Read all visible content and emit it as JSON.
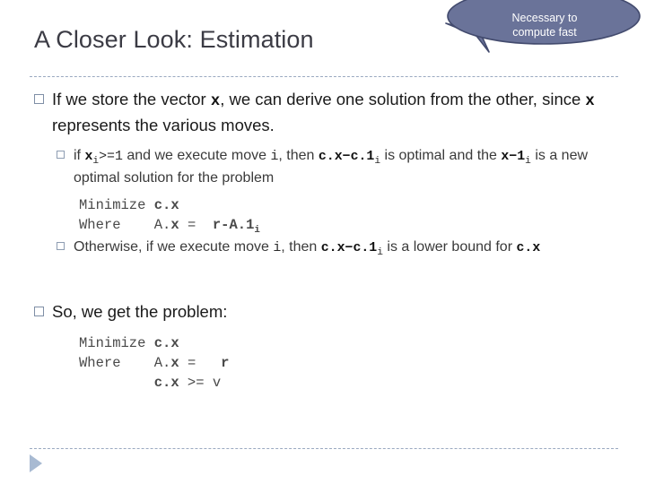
{
  "slide": {
    "title": "A Closer Look: Estimation",
    "callout": {
      "line1": "Necessary to",
      "line2": "compute fast",
      "fill": "#6a7399",
      "stroke": "#434b6e",
      "text_color": "#ffffff"
    },
    "rule_color": "#9aa9c0",
    "arrow_color": "#a8bad2",
    "bullets": [
      {
        "level": 1,
        "id": "bullet-store-vector",
        "segments": [
          {
            "text": "If we store the vector ",
            "style": "plain"
          },
          {
            "text": "x",
            "style": "mono-bold"
          },
          {
            "text": ", we can derive one solution from the other, since ",
            "style": "plain"
          },
          {
            "text": "x",
            "style": "mono-bold"
          },
          {
            "text": " represents the various moves.",
            "style": "plain"
          }
        ]
      },
      {
        "level": 2,
        "id": "bullet-if-xi-ge-1",
        "segments": [
          {
            "text": "if ",
            "style": "plain"
          },
          {
            "text": "x",
            "style": "mono-bold"
          },
          {
            "text": "i",
            "style": "mono-sub"
          },
          {
            "text": ">=1",
            "style": "mono"
          },
          {
            "text": " and we execute move ",
            "style": "plain"
          },
          {
            "text": "i",
            "style": "mono"
          },
          {
            "text": ", then ",
            "style": "plain"
          },
          {
            "text": "c.x",
            "style": "mono-bold"
          },
          {
            "text": "−",
            "style": "mono-bold"
          },
          {
            "text": "c.1",
            "style": "mono-bold"
          },
          {
            "text": "i",
            "style": "mono-sub"
          },
          {
            "text": " is optimal and the ",
            "style": "plain"
          },
          {
            "text": "x",
            "style": "mono-bold"
          },
          {
            "text": "−1",
            "style": "mono-bold"
          },
          {
            "text": "i",
            "style": "mono-sub"
          },
          {
            "text": " is a new optimal solution for the problem",
            "style": "plain"
          }
        ]
      },
      {
        "level": 2,
        "id": "bullet-otherwise",
        "segments": [
          {
            "text": "Otherwise, if we execute move ",
            "style": "plain"
          },
          {
            "text": "i",
            "style": "mono"
          },
          {
            "text": ", then ",
            "style": "plain"
          },
          {
            "text": "c.x",
            "style": "mono-bold"
          },
          {
            "text": "−",
            "style": "mono-bold"
          },
          {
            "text": "c.1",
            "style": "mono-bold"
          },
          {
            "text": "i",
            "style": "mono-sub"
          },
          {
            "text": " is a lower bound for ",
            "style": "plain"
          },
          {
            "text": "c.x",
            "style": "mono-bold"
          }
        ]
      },
      {
        "level": 1,
        "id": "bullet-so-we-get",
        "segments": [
          {
            "text": "So, we get the problem:",
            "style": "plain"
          }
        ]
      }
    ],
    "code_block_1": {
      "id": "code-block-subproblem",
      "lines": [
        {
          "parts": [
            {
              "t": "Minimize ",
              "b": false
            },
            {
              "t": "c.x",
              "b": true
            }
          ]
        },
        {
          "parts": [
            {
              "t": "Where    ",
              "b": false
            },
            {
              "t": "A.",
              "b": false
            },
            {
              "t": "x",
              "b": true
            },
            {
              "t": " =  ",
              "b": false
            },
            {
              "t": "r-A.1",
              "b": true
            },
            {
              "t": "i",
              "b": true,
              "sub": true
            }
          ]
        }
      ]
    },
    "code_block_2": {
      "id": "code-block-final-problem",
      "lines": [
        {
          "parts": [
            {
              "t": "Minimize ",
              "b": false
            },
            {
              "t": "c.x",
              "b": true
            }
          ]
        },
        {
          "parts": [
            {
              "t": "Where    ",
              "b": false
            },
            {
              "t": "A.",
              "b": false
            },
            {
              "t": "x",
              "b": true
            },
            {
              "t": " =   ",
              "b": false
            },
            {
              "t": "r",
              "b": true
            }
          ]
        },
        {
          "parts": [
            {
              "t": "         ",
              "b": false
            },
            {
              "t": "c.x",
              "b": true
            },
            {
              "t": " >= ",
              "b": false
            },
            {
              "t": "v",
              "b": false
            }
          ]
        }
      ]
    }
  }
}
